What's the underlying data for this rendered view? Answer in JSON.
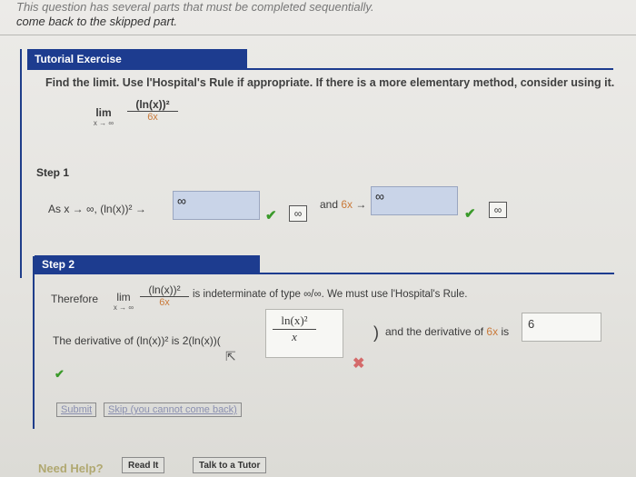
{
  "top_note": {
    "line1": "This question has several parts that must be completed sequentially.",
    "line2": "come back to the skipped part."
  },
  "tutorial": {
    "header": "Tutorial Exercise",
    "instruction": "Find the limit. Use l'Hospital's Rule if appropriate. If there is a more elementary method, consider using it.",
    "limit": {
      "lim": "lim",
      "sub": "x → ∞",
      "num": "(ln(x))²",
      "den": "6x"
    }
  },
  "step1": {
    "label": "Step 1",
    "as_text": "As x → ∞, (ln(x))² →",
    "field1_value": "∞",
    "answer1": "∞",
    "and_text": "and",
    "and_expr": "6x",
    "arrow": "→",
    "field2_value": "∞",
    "answer2": "∞"
  },
  "step2": {
    "label": "Step 2",
    "therefore": "Therefore",
    "lim": "lim",
    "sub": "x → ∞",
    "num": "(ln(x))²",
    "den": "6x",
    "indeterminate": "is indeterminate of type ∞/∞. We must use l'Hospital's Rule.",
    "deriv_prefix": "The derivative of (ln(x))² is 2(ln(x))(",
    "deriv_input_num": "ln(x)²",
    "deriv_input_den": "x",
    "deriv_suffix": ")",
    "and_deriv_text": "and the derivative of",
    "and_deriv_expr": "6x",
    "and_deriv_is": "is",
    "sixx_value": "6"
  },
  "buttons": {
    "submit": "Submit",
    "skip": "Skip (you cannot come back)"
  },
  "help": {
    "need_help": "Need Help?",
    "read_it": "Read It",
    "talk_tutor": "Talk to a Tutor"
  },
  "icons": {
    "check": "checkmark-icon",
    "x": "x-mark-icon",
    "cursor": "mouse-cursor-icon"
  },
  "colors": {
    "accent": "#1d3c8f",
    "correct": "#3a9a2a",
    "incorrect": "#d46a6a",
    "input_fill": "#c9d4e8",
    "variable_orange": "#c97a3a"
  }
}
